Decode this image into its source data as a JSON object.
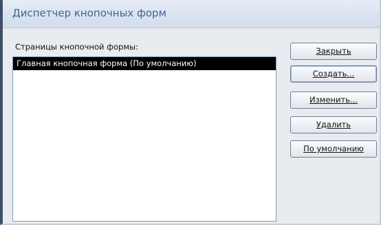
{
  "window": {
    "title": "Диспетчер кнопочных форм"
  },
  "list": {
    "label": "Страницы кнопочной формы:",
    "items": [
      {
        "label": "Главная кнопочная форма (По умолчанию)",
        "selected": true
      }
    ]
  },
  "buttons": {
    "close": "Закрыть",
    "create": "Создать...",
    "edit": "Изменить...",
    "delete": "Удалить",
    "default": "По умолчанию"
  }
}
